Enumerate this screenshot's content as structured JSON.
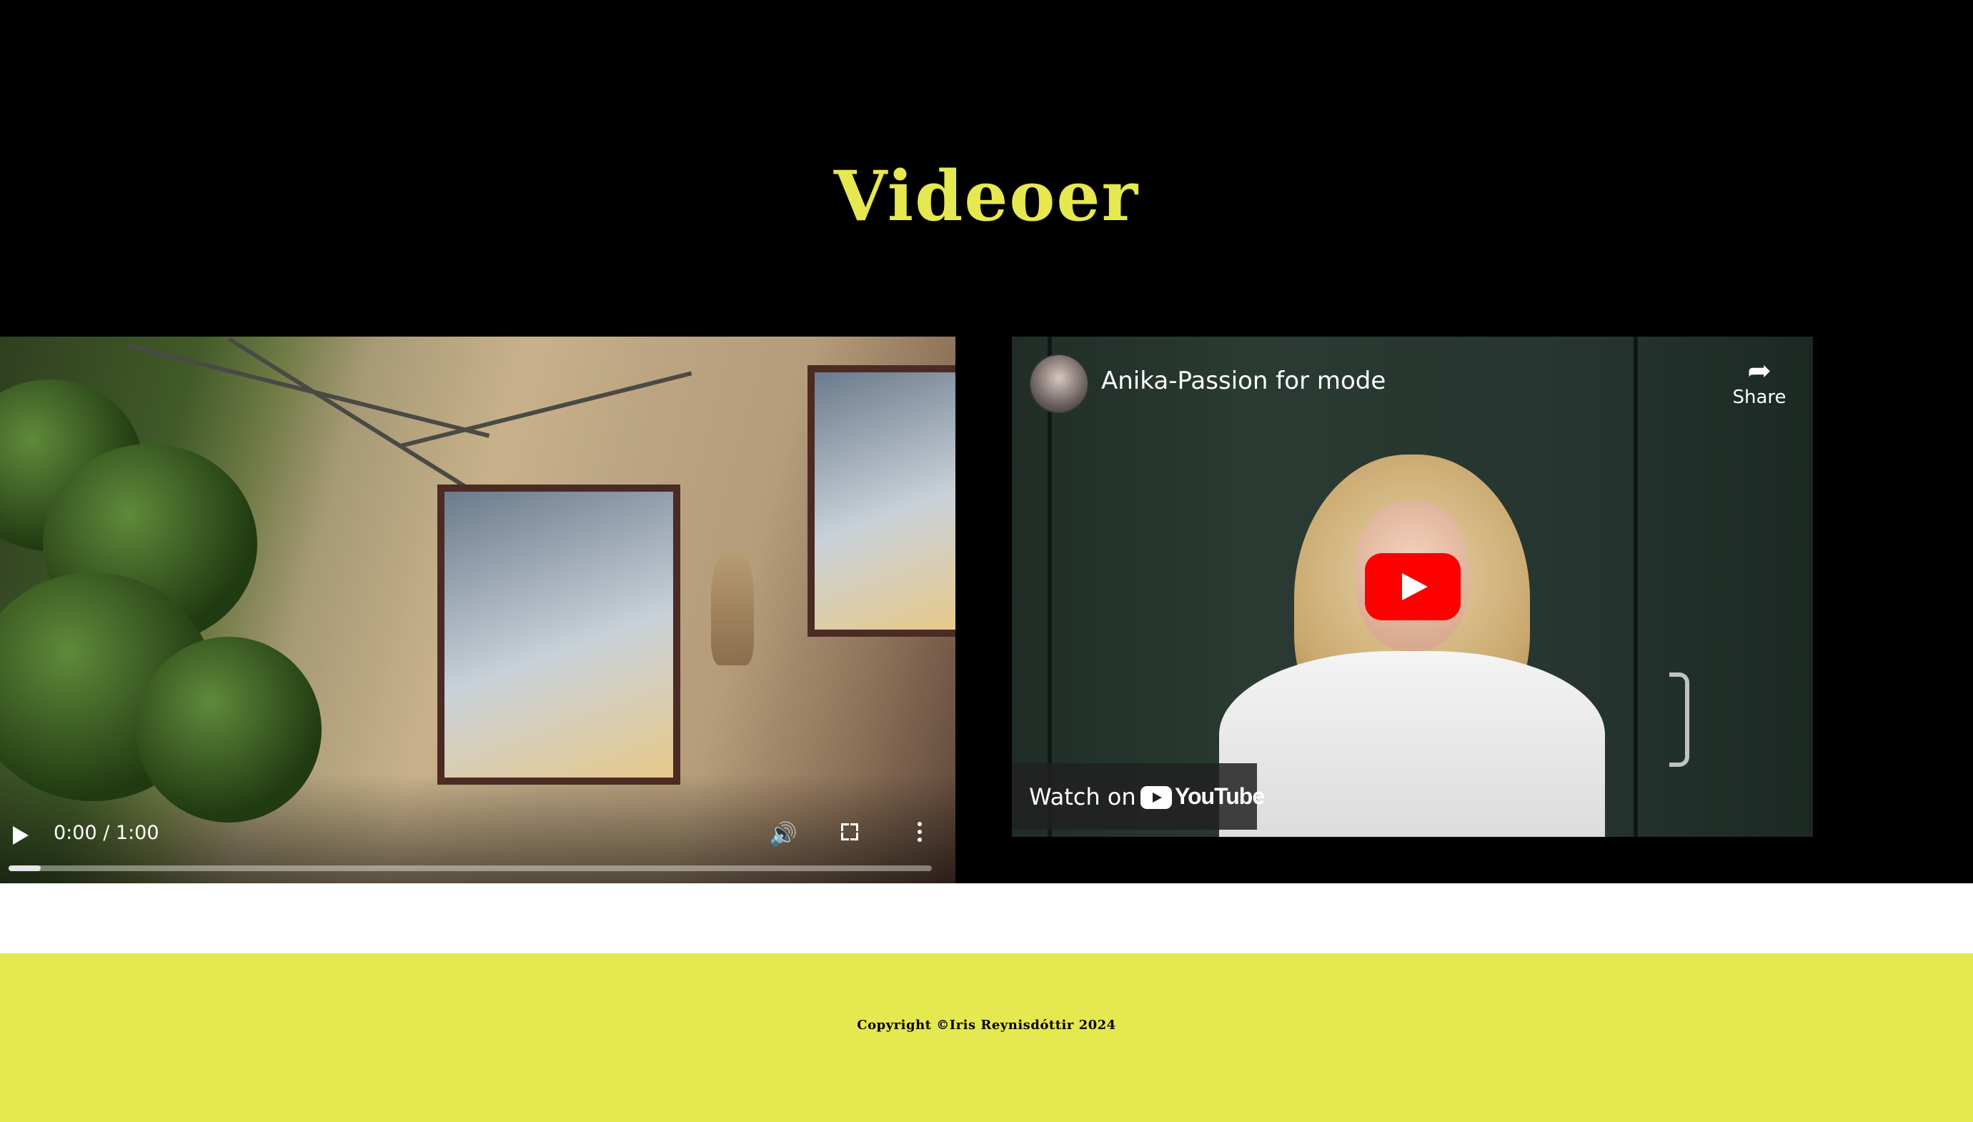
{
  "page": {
    "title": "Videoer",
    "accent_color": "#e6e84f",
    "background_color": "#000000"
  },
  "video_left": {
    "kind": "native-video-player",
    "time_display": "0:00 / 1:00",
    "progress": 0.035,
    "controls": [
      "play-icon",
      "volume-icon",
      "fullscreen-icon",
      "more-options-icon"
    ]
  },
  "video_right": {
    "kind": "youtube-embed",
    "title": "Anika-Passion for mode",
    "share_label": "Share",
    "watch_on_label": "Watch on",
    "logo_text": "YouTube",
    "play_button_color": "#ff0000"
  },
  "footer": {
    "copyright": "Copyright ©Iris Reynisdóttir 2024",
    "background_color": "#e6e84f"
  }
}
